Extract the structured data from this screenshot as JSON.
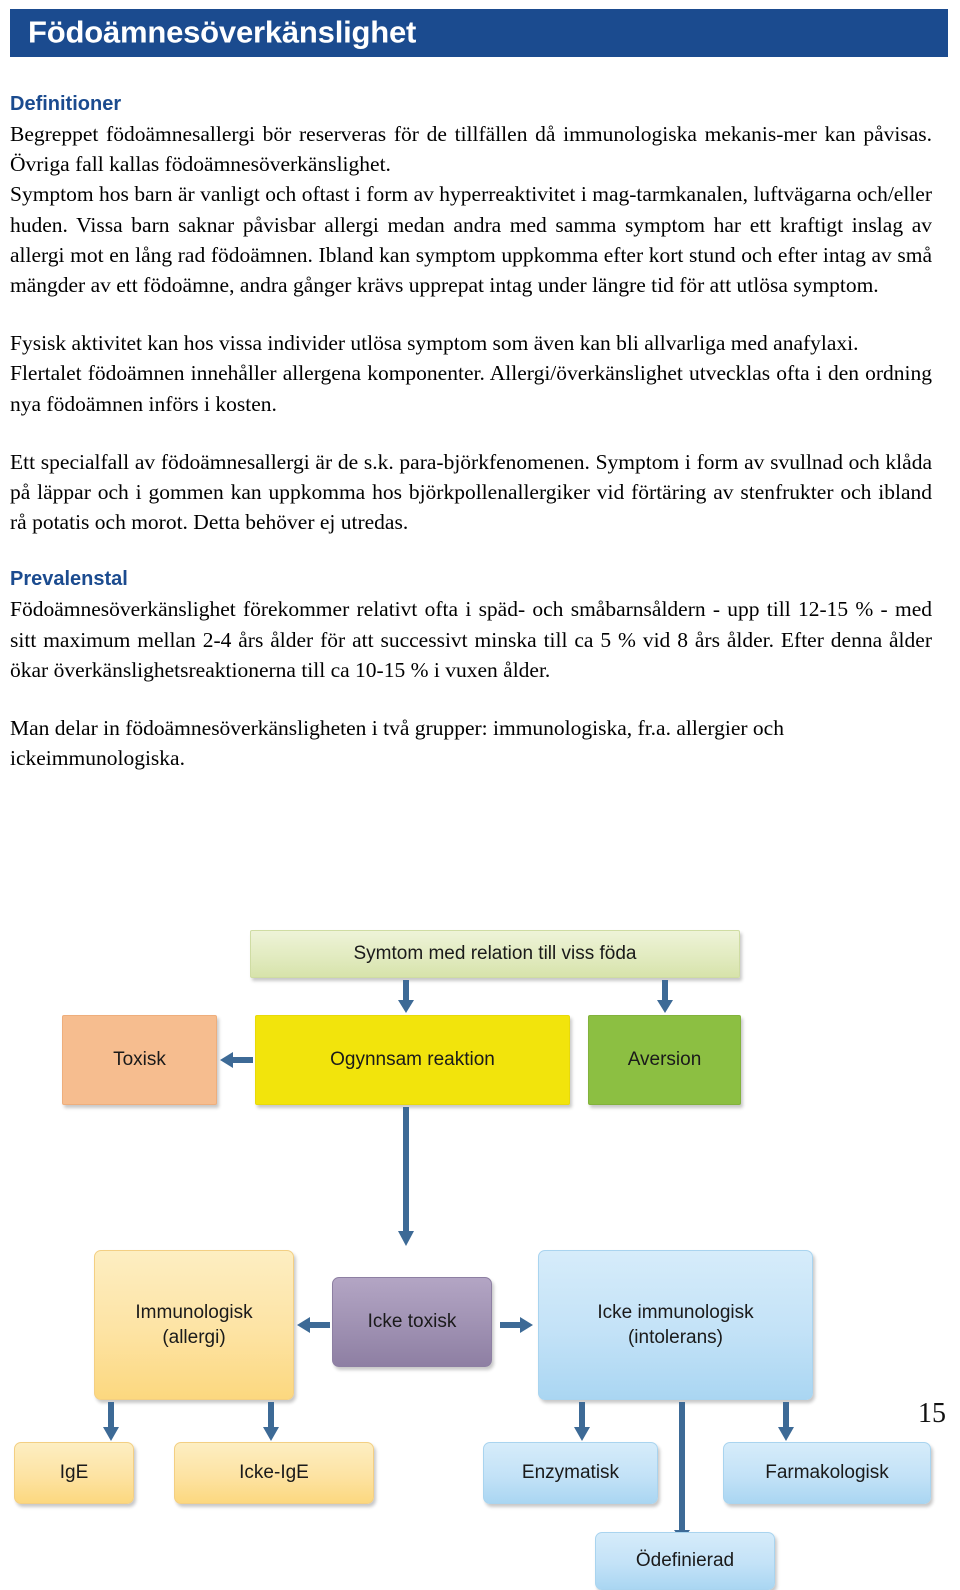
{
  "header": {
    "title": "Födoämnesöverkänslighet",
    "banner_color": "#1b4b8f",
    "text_color": "#ffffff"
  },
  "sections": [
    {
      "heading": "Definitioner",
      "heading_color": "#1b4b8f",
      "paragraphs": [
        "Begreppet födoämnesallergi bör reserveras för de tillfällen då immunologiska mekanis-mer kan påvisas. Övriga fall kallas födoämnesöverkänslighet.",
        "Symptom hos barn är vanligt och oftast i form av hyperreaktivitet i mag-tarmkanalen, luftvägarna och/eller huden. Vissa barn saknar påvisbar allergi medan andra med samma symptom har ett kraftigt inslag av allergi mot en lång rad födoämnen. Ibland kan symptom uppkomma efter kort stund och efter intag av små mängder av ett födoämne, andra gånger krävs upprepat intag under längre tid för att utlösa symptom.",
        "Fysisk aktivitet kan hos vissa individer utlösa symptom som även kan bli allvarliga med anafylaxi.",
        "Flertalet födoämnen innehåller allergena komponenter. Allergi/överkänslighet utvecklas ofta i den ordning nya födoämnen införs i kosten.",
        "Ett specialfall av födoämnesallergi är de s.k. para-björkfenomenen. Symptom i form av svullnad och klåda på läppar och i gommen kan uppkomma hos björkpollenallergiker vid förtäring av stenfrukter och ibland rå potatis och morot. Detta behöver ej utredas."
      ]
    },
    {
      "heading": "Prevalenstal",
      "heading_color": "#1b4b8f",
      "paragraphs": [
        "Födoämnesöverkänslighet förekommer relativt ofta i späd- och småbarnsåldern - upp till 12-15 % - med sitt maximum mellan 2-4 års ålder för att successivt minska till ca 5 % vid 8 års ålder. Efter denna ålder ökar överkänslighetsreaktionerna till ca 10-15 % i vuxen ålder.",
        "Man delar in födoämnesöverkänsligheten i två grupper: immunologiska, fr.a. allergier och ickeimmunologiska."
      ]
    }
  ],
  "diagram": {
    "nodes": {
      "symtom": {
        "label": "Symtom med relation till viss föda",
        "color": "#e2ebc0"
      },
      "ogynnsam": {
        "label": "Ogynnsam reaktion",
        "color": "#f2e40c"
      },
      "toxisk": {
        "label": "Toxisk",
        "color": "#f6bd8f"
      },
      "aversion": {
        "label": "Aversion",
        "color": "#8cbf42"
      },
      "icke_toxisk": {
        "label": "Icke toxisk",
        "color": "#a193b4"
      },
      "immunologisk_l1": {
        "label": "Immunologisk",
        "color": "#fde3a3"
      },
      "immunologisk_l2": {
        "label": "(allergi)",
        "color": "#fde3a3"
      },
      "icke_immunologisk_l1": {
        "label": "Icke immunologisk",
        "color": "#c3e2f7"
      },
      "icke_immunologisk_l2": {
        "label": "(intolerans)",
        "color": "#c3e2f7"
      },
      "ige": {
        "label": "IgE",
        "color": "#fde3a3"
      },
      "icke_ige": {
        "label": "Icke-IgE",
        "color": "#fde3a3"
      },
      "enzymatisk": {
        "label": "Enzymatisk",
        "color": "#c3e2f7"
      },
      "farmakologisk": {
        "label": "Farmakologisk",
        "color": "#c3e2f7"
      },
      "odefinierad": {
        "label": "Ödefinierad",
        "color": "#c3e2f7"
      }
    },
    "arrow_color": "#3d6a96"
  },
  "footer": {
    "page_number": "15"
  }
}
